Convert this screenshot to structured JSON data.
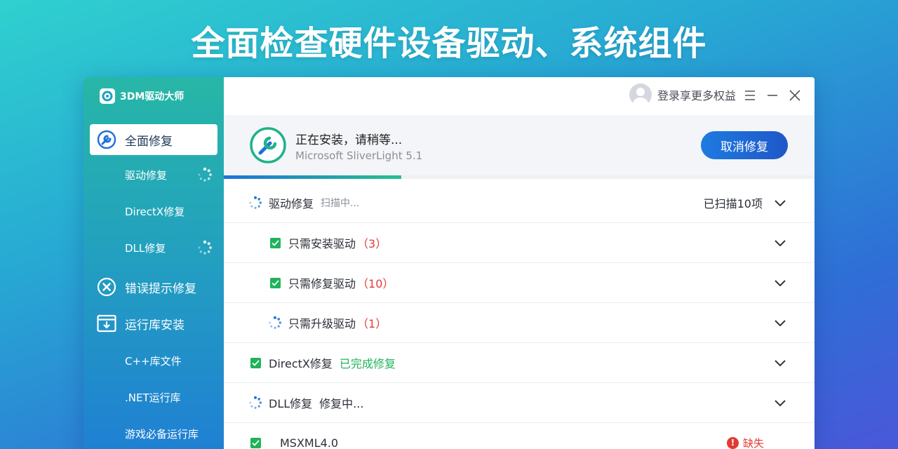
{
  "banner": {
    "title": "全面检查硬件设备驱动、系统组件"
  },
  "app": {
    "name": "3DM驱动大师"
  },
  "sidebar": {
    "main_items": [
      {
        "label": "全面修复",
        "icon": "wrench-repair-icon",
        "active": true
      },
      {
        "label": "错误提示修复",
        "icon": "x-circle-icon"
      },
      {
        "label": "运行库安装",
        "icon": "window-download-icon"
      }
    ],
    "sub_items": [
      {
        "label": "驱动修复",
        "spinner": true
      },
      {
        "label": "DirectX修复",
        "spinner": false
      },
      {
        "label": "DLL修复",
        "spinner": true
      },
      {
        "label": "C++库文件",
        "spinner": false
      },
      {
        "label": ".NET运行库",
        "spinner": false
      },
      {
        "label": "游戏必备运行库",
        "spinner": false
      }
    ]
  },
  "titlebar": {
    "login_text": "登录享更多权益",
    "menu_icon": "menu-icon",
    "minimize_icon": "minimize-icon",
    "close_icon": "close-icon"
  },
  "status": {
    "title": "正在安装，请稍等...",
    "subtitle": "Microsoft SliverLight 5.1",
    "cancel_label": "取消修复",
    "progress_percent": 30
  },
  "rows": [
    {
      "label": "驱动修复",
      "state": "spinner",
      "extra": "扫描中...",
      "right_text": "已扫描10项"
    },
    {
      "label": "只需安装驱动",
      "state": "checked",
      "count": "（3）"
    },
    {
      "label": "只需修复驱动",
      "state": "checked",
      "count": "（10）"
    },
    {
      "label": "只需升级驱动",
      "state": "spinner",
      "count": "（1）"
    },
    {
      "label": "DirectX修复",
      "state": "checked",
      "done": "已完成修复"
    },
    {
      "label": "DLL修复",
      "state": "spinner",
      "busy": "修复中..."
    },
    {
      "label": "MSXML4.0",
      "state": "checked",
      "missing": "缺失"
    }
  ],
  "colors": {
    "accent_blue": "#1f6fd8",
    "success_green": "#1fb35a",
    "error_red": "#e33b35"
  }
}
